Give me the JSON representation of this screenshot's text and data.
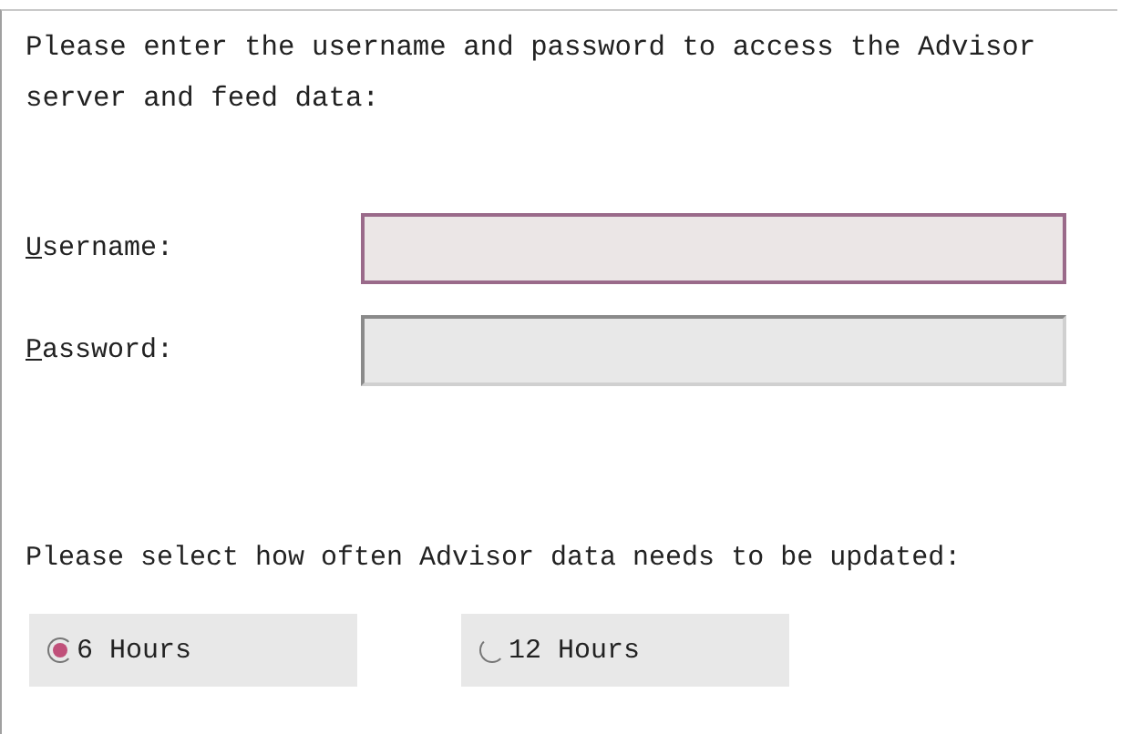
{
  "intro": "Please enter the username and password to access the Advisor server and feed data:",
  "fields": [
    {
      "label": "Username:",
      "focused": true
    },
    {
      "label": "Password:",
      "focused": false
    }
  ],
  "frequency_prompt": "Please select how often Advisor data needs to be updated:",
  "options": [
    {
      "label": "6 Hours",
      "selected": true
    },
    {
      "label": "12 Hours",
      "selected": false
    }
  ]
}
